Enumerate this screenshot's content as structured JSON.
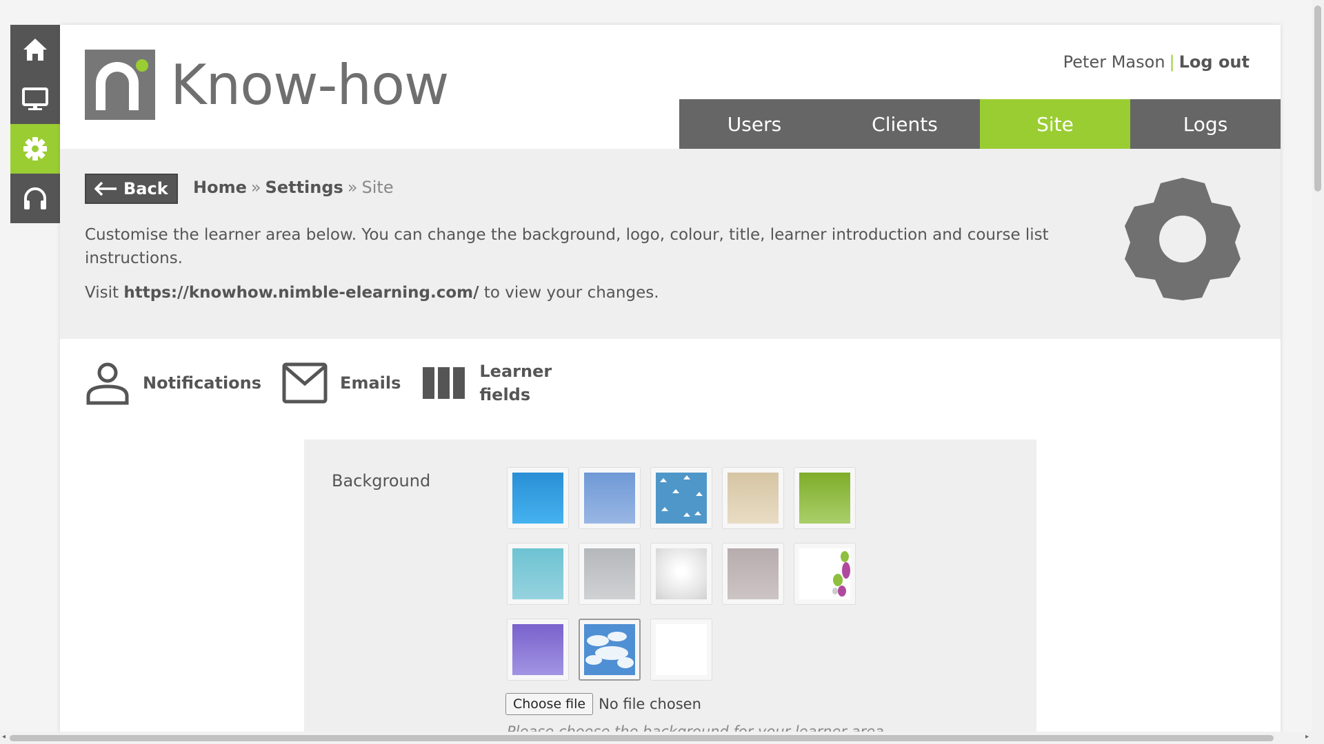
{
  "sidebar": {
    "items": [
      {
        "icon": "home-icon"
      },
      {
        "icon": "desktop-icon"
      },
      {
        "icon": "gear-icon",
        "active": true
      },
      {
        "icon": "headphones-icon"
      }
    ]
  },
  "brand": {
    "name": "Know-how",
    "accent": "#9acd32",
    "dark": "#555555"
  },
  "user": {
    "name": "Peter Mason",
    "separator": "|",
    "logout_label": "Log out"
  },
  "nav": {
    "tabs": [
      {
        "label": "Users"
      },
      {
        "label": "Clients"
      },
      {
        "label": "Site",
        "active": true
      },
      {
        "label": "Logs"
      }
    ]
  },
  "header": {
    "back_label": "Back",
    "breadcrumb": {
      "home": "Home",
      "settings": "Settings",
      "current": "Site",
      "separator": "»"
    },
    "intro": "Customise the learner area below. You can change the background, logo, colour, title, learner introduction and course list instructions.",
    "visit_prefix": "Visit",
    "visit_url": "https://knowhow.nimble-elearning.com/",
    "visit_suffix": "to view your changes."
  },
  "subnav": {
    "notifications": "Notifications",
    "emails": "Emails",
    "learner_fields_1": "Learner",
    "learner_fields_2": "fields"
  },
  "background": {
    "label": "Background",
    "choose_file": "Choose file",
    "no_file": "No file chosen",
    "hint": "Please choose the background for your learner area."
  }
}
